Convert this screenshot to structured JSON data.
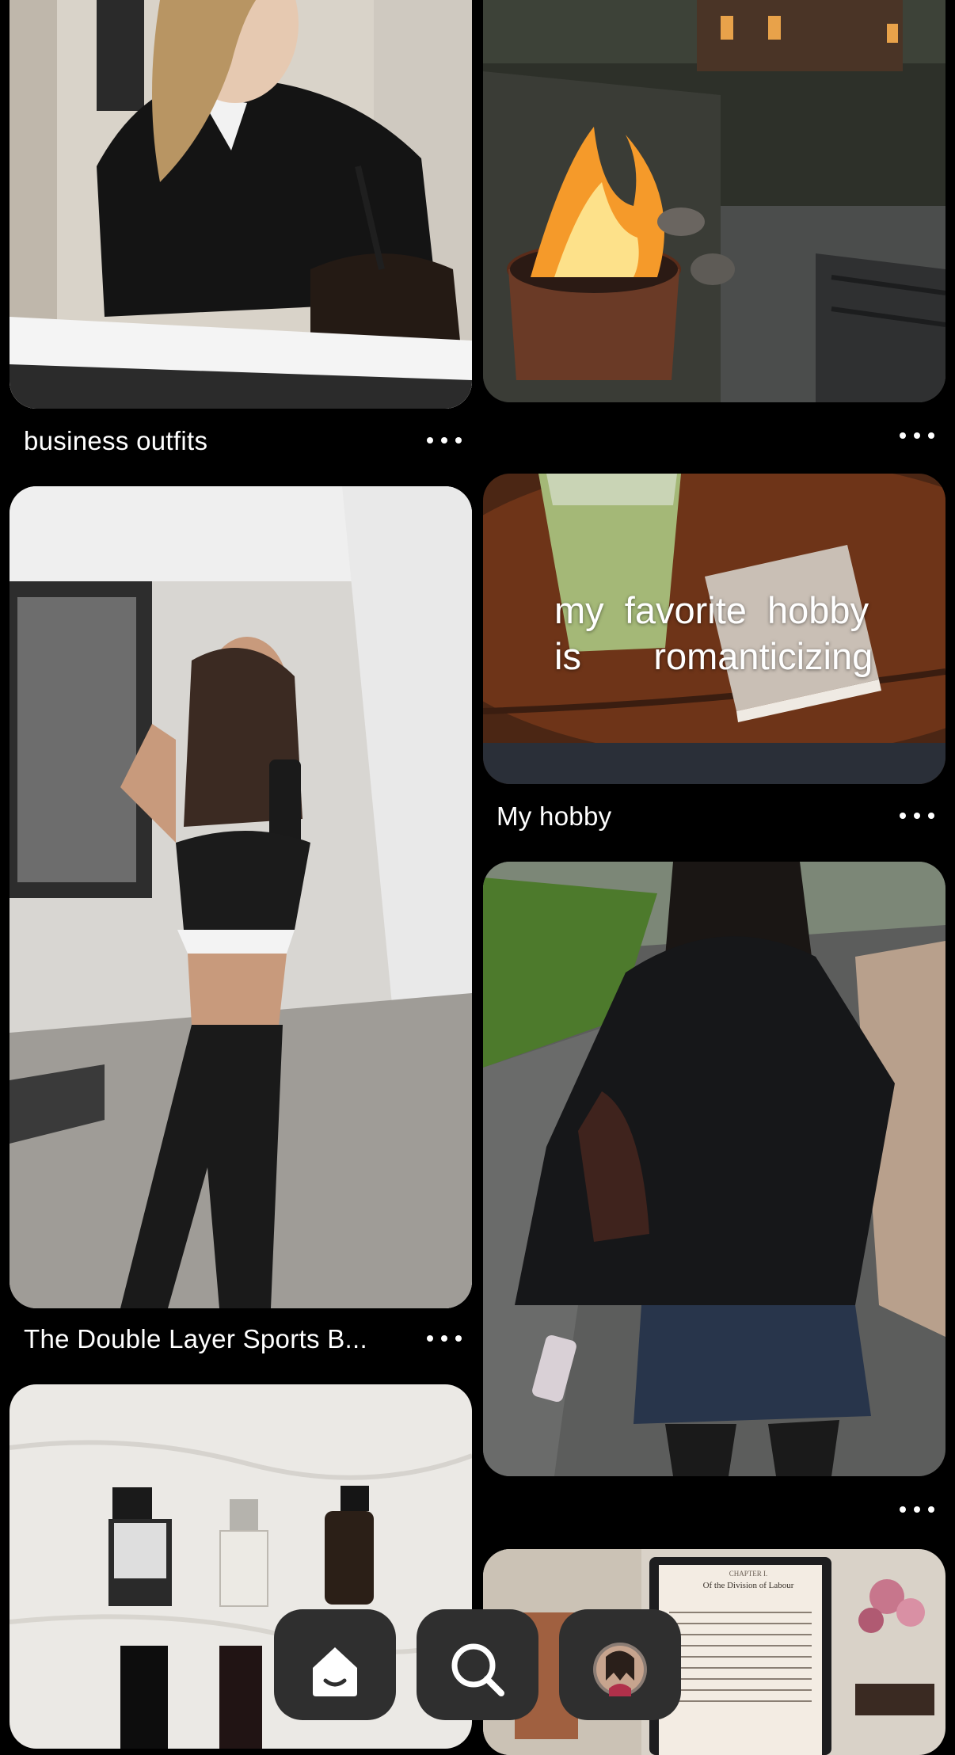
{
  "feed": {
    "pins": [
      {
        "id": "p1",
        "caption": "business outfits",
        "has_caption": true
      },
      {
        "id": "p2",
        "caption": "",
        "has_caption": false
      },
      {
        "id": "p3",
        "caption": "My hobby",
        "has_caption": true,
        "overlay_line1": "my  favorite  hobby",
        "overlay_line2": "is       romanticizing"
      },
      {
        "id": "p4",
        "caption": "The Double Layer Sports B...",
        "has_caption": true
      },
      {
        "id": "p5",
        "caption": "",
        "has_caption": false
      },
      {
        "id": "p6",
        "caption": "",
        "has_caption": false
      },
      {
        "id": "p7",
        "caption": "",
        "has_caption": false,
        "book_heading": "Of the Division of Labour",
        "book_chapter": "CHAPTER I."
      }
    ],
    "more_label": "•••"
  },
  "bottom_nav": {
    "items": [
      {
        "name": "home",
        "icon": "home-icon",
        "active": true
      },
      {
        "name": "search",
        "icon": "search-icon",
        "active": false
      },
      {
        "name": "profile",
        "icon": "avatar",
        "active": false
      }
    ]
  },
  "colors": {
    "background": "#000000",
    "nav_button": "#2f2f2f",
    "text": "#ffffff"
  }
}
